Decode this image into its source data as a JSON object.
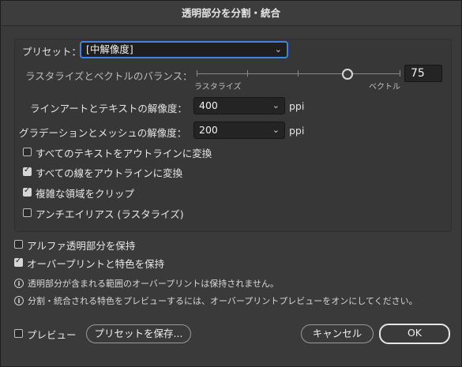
{
  "window": {
    "title": "透明部分を分割・統合"
  },
  "preset": {
    "label": "プリセット：",
    "value": "[中解像度]"
  },
  "balance": {
    "label": "ラスタライズとベクトルのバランス：",
    "value": "75",
    "left_label": "ラスタライズ",
    "right_label": "ベクトル",
    "level": 0.75
  },
  "line_art": {
    "label": "ラインアートとテキストの解像度：",
    "value": "400",
    "unit": "ppi"
  },
  "gradient": {
    "label": "グラデーションとメッシュの解像度：",
    "value": "200",
    "unit": "ppi"
  },
  "options": [
    {
      "label": "すべてのテキストをアウトラインに変換",
      "checked": false
    },
    {
      "label": "すべての線をアウトラインに変換",
      "checked": true
    },
    {
      "label": "複雑な領域をクリップ",
      "checked": true
    },
    {
      "label": "アンチエイリアス (ラスタライズ)",
      "checked": false
    }
  ],
  "keep_alpha": {
    "label": "アルファ透明部分を保持",
    "checked": false
  },
  "keep_overprint": {
    "label": "オーバープリントと特色を保持",
    "checked": true
  },
  "info1": "透明部分が含まれる範囲のオーバープリントは保持されません。",
  "info2": "分割・統合される特色をプレビューするには、オーバープリントプレビューをオンにしてください。",
  "footer": {
    "preview_label": "プレビュー",
    "save_preset": "プリセットを保存...",
    "cancel": "キャンセル",
    "ok": "OK"
  }
}
